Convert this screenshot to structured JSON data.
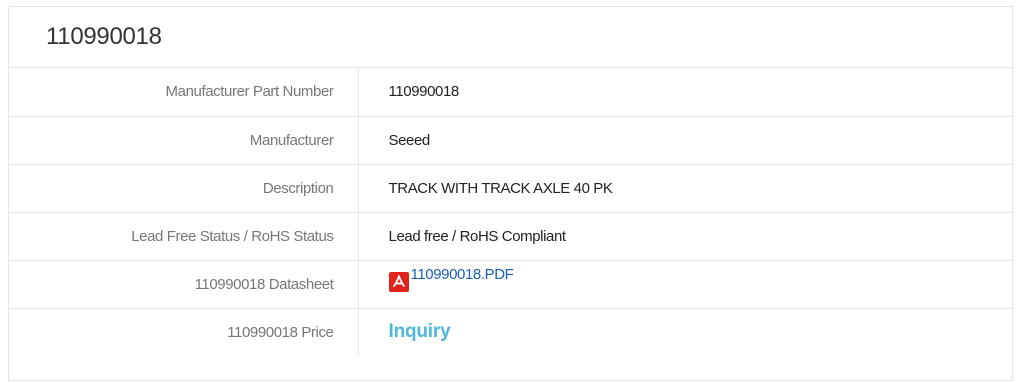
{
  "header": {
    "title": "110990018"
  },
  "rows": [
    {
      "label": "Manufacturer Part Number",
      "value": "110990018"
    },
    {
      "label": "Manufacturer",
      "value": "Seeed"
    },
    {
      "label": "Description",
      "value": "TRACK WITH TRACK AXLE 40 PK"
    },
    {
      "label": "Lead Free Status / RoHS Status",
      "value": "Lead free / RoHS Compliant"
    },
    {
      "label": "110990018 Datasheet",
      "value": "110990018.PDF",
      "icon": "pdf-icon"
    },
    {
      "label": "110990018 Price",
      "value": "Inquiry"
    }
  ],
  "colors": {
    "link": "#1a5fb4",
    "inquiry": "#4fb8d8",
    "pdf_icon": "#e2231a",
    "border": "#e4e4e4"
  }
}
